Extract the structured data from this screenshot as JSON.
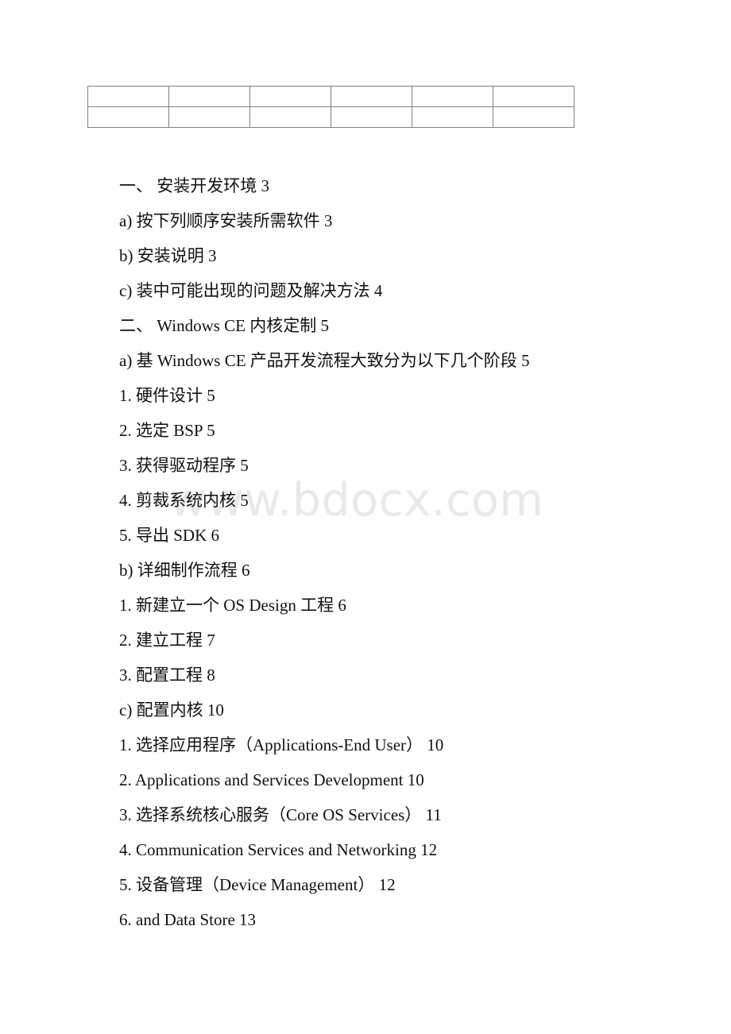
{
  "document": {
    "watermark": "www.bdocx.com",
    "table": {
      "rows": 2,
      "columns": 6,
      "cells": [
        [
          "",
          "",
          "",
          "",
          "",
          ""
        ],
        [
          "",
          "",
          "",
          "",
          "",
          ""
        ]
      ]
    },
    "outline": [
      {
        "text": "一、 安装开发环境 3"
      },
      {
        "text": "a) 按下列顺序安装所需软件 3"
      },
      {
        "text": "b) 安装说明 3"
      },
      {
        "text": "c) 装中可能出现的问题及解决方法 4"
      },
      {
        "text": "二、 Windows CE 内核定制 5"
      },
      {
        "text": "a) 基 Windows CE 产品开发流程大致分为以下几个阶段 5"
      },
      {
        "text": "1. 硬件设计 5"
      },
      {
        "text": "2. 选定 BSP 5"
      },
      {
        "text": "3. 获得驱动程序 5"
      },
      {
        "text": "4. 剪裁系统内核 5"
      },
      {
        "text": "5. 导出 SDK 6"
      },
      {
        "text": "b) 详细制作流程 6"
      },
      {
        "text": "1. 新建立一个 OS Design 工程 6"
      },
      {
        "text": "2. 建立工程 7"
      },
      {
        "text": "3. 配置工程 8"
      },
      {
        "text": "c) 配置内核 10"
      },
      {
        "text": "1. 选择应用程序（Applications-End User） 10"
      },
      {
        "text": "2. Applications and Services Development 10"
      },
      {
        "text": "3. 选择系统核心服务（Core OS Services） 11"
      },
      {
        "text": "4. Communication Services and Networking 12"
      },
      {
        "text": "5. 设备管理（Device Management） 12"
      },
      {
        "text": "6.  and Data Store 13"
      }
    ]
  }
}
